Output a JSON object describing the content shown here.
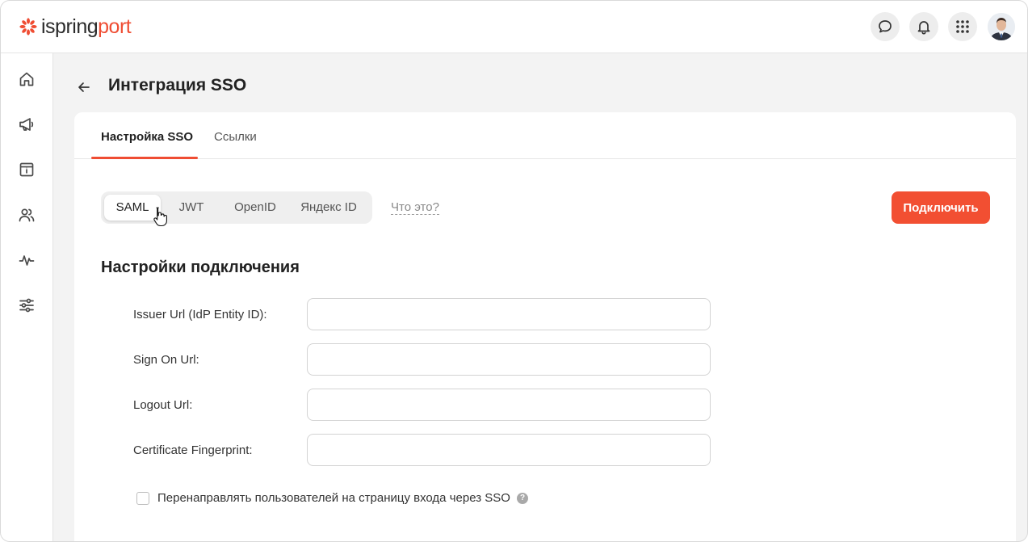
{
  "header": {
    "logo": {
      "part1": "ispring",
      "part2": "port"
    },
    "icons": [
      "chat-icon",
      "bell-icon",
      "apps-grid-icon"
    ]
  },
  "sidebar": {
    "items": [
      {
        "icon": "home-icon"
      },
      {
        "icon": "megaphone-icon"
      },
      {
        "icon": "info-board-icon"
      },
      {
        "icon": "users-icon"
      },
      {
        "icon": "activity-icon"
      },
      {
        "icon": "sliders-icon"
      }
    ]
  },
  "page": {
    "title": "Интеграция SSO"
  },
  "tabs": [
    {
      "label": "Настройка SSO",
      "active": true
    },
    {
      "label": "Ссылки",
      "active": false
    }
  ],
  "protocols": {
    "options": [
      {
        "label": "SAML",
        "active": true
      },
      {
        "label": "JWT",
        "active": false
      },
      {
        "label": "OpenID",
        "active": false
      },
      {
        "label": "Яндекс ID",
        "active": false
      }
    ],
    "help_link": "Что это?"
  },
  "actions": {
    "connect_label": "Подключить"
  },
  "connection": {
    "title": "Настройки подключения",
    "fields": [
      {
        "label": "Issuer Url (IdP Entity ID):",
        "value": ""
      },
      {
        "label": "Sign On Url:",
        "value": ""
      },
      {
        "label": "Logout Url:",
        "value": ""
      },
      {
        "label": "Certificate Fingerprint:",
        "value": ""
      }
    ],
    "redirect_checkbox": {
      "label": "Перенаправлять пользователей на страницу входа через SSO",
      "checked": false
    }
  },
  "colors": {
    "accent": "#f24f32",
    "background": "#f3f3f3"
  }
}
